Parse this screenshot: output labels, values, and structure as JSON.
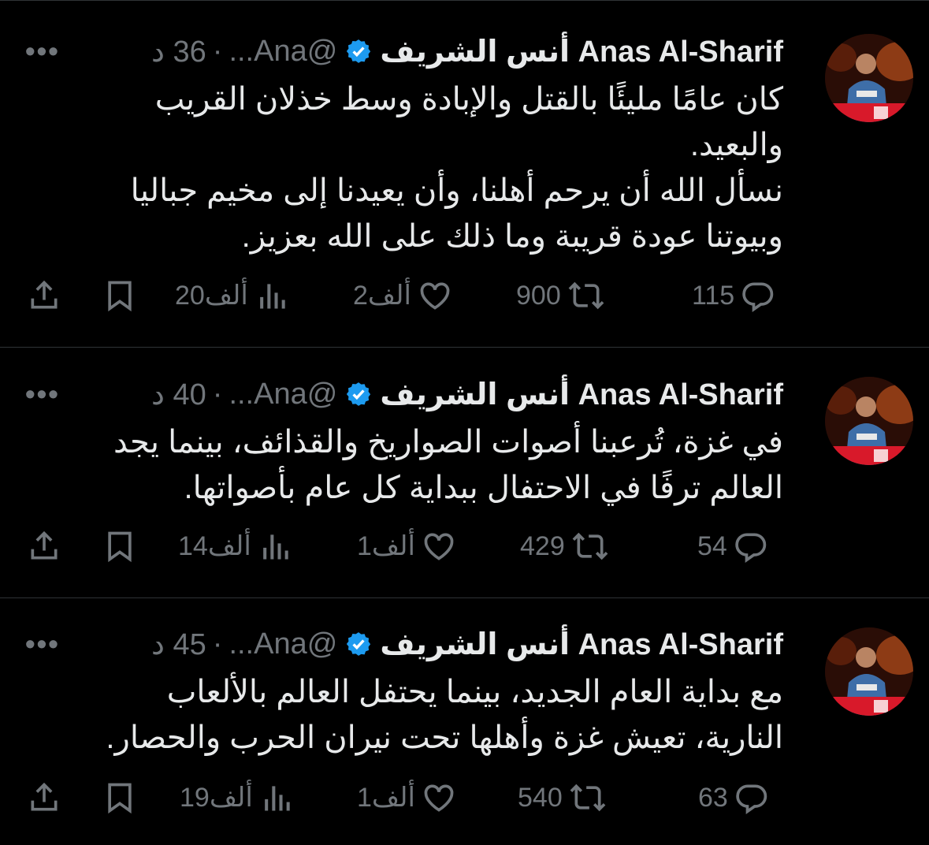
{
  "tweets": [
    {
      "name": "Anas Al-Sharif أنس الشريف",
      "handle": "@Ana...",
      "dot": "·",
      "time": "36 د",
      "more": "•••",
      "text": "كان عامًا مليئًا بالقتل والإبادة وسط خذلان القريب\nوالبعيد.\nنسأل الله أن يرحم أهلنا، وأن يعيدنا إلى مخيم جباليا\nوبيوتنا عودة قريبة وما ذلك على الله بعزيز.",
      "replies": "115",
      "retweets": "900",
      "likes": "2ألف",
      "views": "20ألف"
    },
    {
      "name": "Anas Al-Sharif أنس الشريف",
      "handle": "@Ana...",
      "dot": "·",
      "time": "40 د",
      "more": "•••",
      "text": "في غزة، تُرعبنا أصوات الصواريخ والقذائف، بينما يجد\nالعالم ترفًا في الاحتفال ببداية كل عام بأصواتها.",
      "replies": "54",
      "retweets": "429",
      "likes": "1ألف",
      "views": "14ألف"
    },
    {
      "name": "Anas Al-Sharif أنس الشريف",
      "handle": "@Ana...",
      "dot": "·",
      "time": "45 د",
      "more": "•••",
      "text": "مع بداية العام الجديد، بينما يحتفل العالم بالألعاب\nالنارية، تعيش غزة وأهلها تحت نيران الحرب والحصار.",
      "replies": "63",
      "retweets": "540",
      "likes": "1ألف",
      "views": "19ألف"
    }
  ],
  "icons": {
    "verified": "verified-badge-icon",
    "reply": "reply-icon",
    "retweet": "retweet-icon",
    "like": "heart-icon",
    "views": "views-icon",
    "bookmark": "bookmark-icon",
    "share": "share-icon"
  },
  "colors": {
    "background": "#000000",
    "text": "#e7e9ea",
    "muted": "#71767b",
    "verified": "#1d9bf0",
    "divider": "#2f3336"
  }
}
